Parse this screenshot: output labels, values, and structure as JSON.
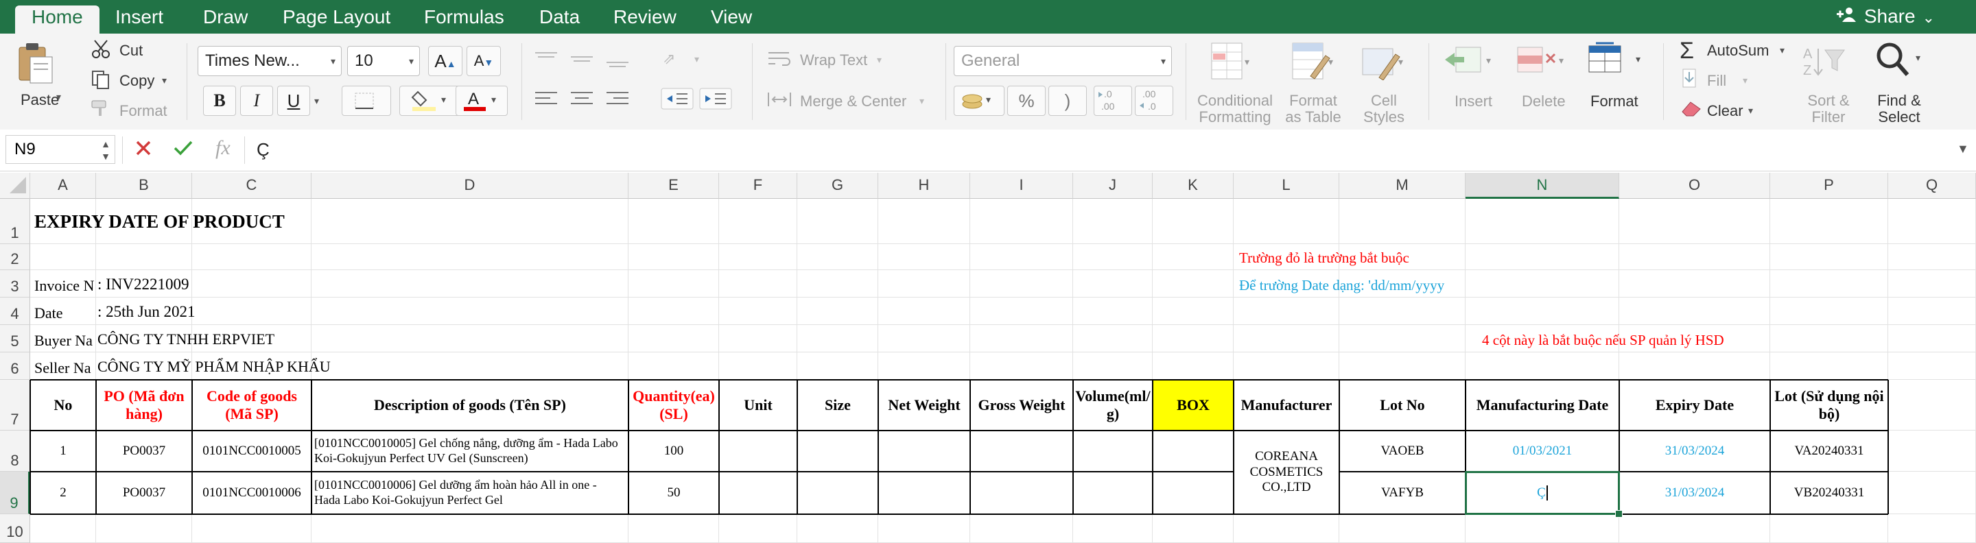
{
  "tabs": [
    "Home",
    "Insert",
    "Draw",
    "Page Layout",
    "Formulas",
    "Data",
    "Review",
    "View"
  ],
  "share_label": "Share",
  "ribbon": {
    "paste": "Paste",
    "cut": "Cut",
    "copy": "Copy",
    "format": "Format",
    "font_name": "Times New...",
    "font_size": "10",
    "bold": "B",
    "italic": "I",
    "underline": "U",
    "wrap_text": "Wrap Text",
    "merge_center": "Merge & Center",
    "number_format": "General",
    "percent": "%",
    "comma": ")",
    "cond_format_1": "Conditional",
    "cond_format_2": "Formatting",
    "format_table_1": "Format",
    "format_table_2": "as Table",
    "cell_styles_1": "Cell",
    "cell_styles_2": "Styles",
    "insert": "Insert",
    "delete": "Delete",
    "format_cells": "Format",
    "autosum": "AutoSum",
    "fill": "Fill",
    "clear": "Clear",
    "sort_filter_1": "Sort &",
    "sort_filter_2": "Filter",
    "find_select_1": "Find &",
    "find_select_2": "Select"
  },
  "formula_bar": {
    "name_box": "N9",
    "fx": "fx",
    "content": "Ç"
  },
  "columns": [
    "A",
    "B",
    "C",
    "D",
    "E",
    "F",
    "G",
    "H",
    "I",
    "J",
    "K",
    "L",
    "M",
    "N",
    "O",
    "P",
    "Q"
  ],
  "rows": [
    "1",
    "2",
    "3",
    "4",
    "5",
    "6",
    "7",
    "8",
    "9",
    "10"
  ],
  "sheet": {
    "title": "EXPIRY DATE OF PRODUCT",
    "note_red": "Trường đỏ là trường bắt buộc",
    "note_blue": "Để trường Date dạng:  'dd/mm/yyyy",
    "note_red2": "4 cột này là bắt buộc nếu SP quản lý HSD",
    "invoice_label": "Invoice N",
    "invoice_value": ": INV2221009",
    "date_label": "Date",
    "date_value": ": 25th Jun 2021",
    "buyer_label": "Buyer Na",
    "buyer_value": "CÔNG TY TNHH ERPVIET",
    "seller_label": "Seller Na",
    "seller_value": "CÔNG TY MỸ PHẨM NHẬP KHẨU",
    "headers": {
      "no": "No",
      "po": "PO (Mã đơn hàng)",
      "code": "Code of goods (Mã SP)",
      "desc": "Description of goods (Tên SP)",
      "qty": "Quantity(ea) (SL)",
      "unit": "Unit",
      "size": "Size",
      "net": "Net Weight",
      "gross": "Gross Weight",
      "vol": "Volume(ml/g)",
      "box": "BOX",
      "manu": "Manufacturer",
      "lot": "Lot No",
      "mfg": "Manufacturing Date",
      "exp": "Expiry Date",
      "lot_internal": "Lot (Sử dụng nội bộ)"
    },
    "manufacturer": "COREANA COSMETICS CO.,LTD",
    "items": [
      {
        "no": "1",
        "po": "PO0037",
        "code": "0101NCC0010005",
        "desc": "[0101NCC0010005] Gel chống nắng, dưỡng ẩm - Hada Labo Koi-Gokujyun Perfect UV Gel (Sunscreen)",
        "qty": "100",
        "lot": "VAOEB",
        "mfg": "01/03/2021",
        "exp": "31/03/2024",
        "lot_internal": "VA20240331"
      },
      {
        "no": "2",
        "po": "PO0037",
        "code": "0101NCC0010006",
        "desc": "[0101NCC0010006] Gel dưỡng ẩm hoàn hảo All in one - Hada Labo Koi-Gokujyun Perfect Gel",
        "qty": "50",
        "lot": "VAFYB",
        "mfg": "Ç",
        "exp": "31/03/2024",
        "lot_internal": "VB20240331"
      }
    ]
  },
  "colors": {
    "excel_green": "#217346",
    "required_red": "#ff0000",
    "date_blue": "#1aa3d9",
    "box_yellow": "#ffff00"
  }
}
